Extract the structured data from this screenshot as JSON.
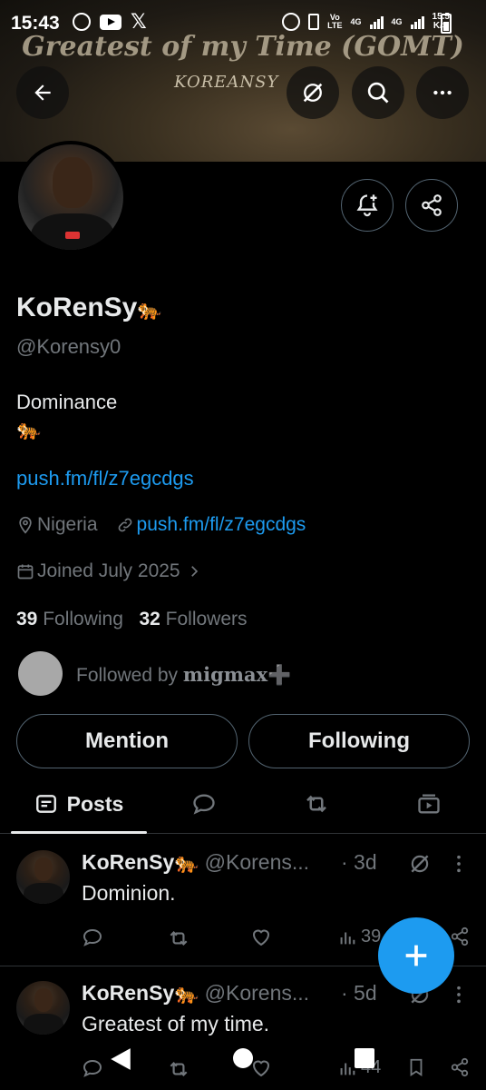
{
  "status_bar": {
    "time": "15:43",
    "net_left": "Vo",
    "net_left2": "LTE",
    "lte1": "4G",
    "lte2": "4G",
    "speed_top": "15.5",
    "speed_bottom": "K/S",
    "app_icons": [
      "whatsapp-icon",
      "youtube-icon",
      "x-icon"
    ]
  },
  "banner": {
    "title": "Greatest of my Time (GOMT)",
    "subtitle": "KOREANSY"
  },
  "profile": {
    "name": "KoRenSy",
    "name_emoji": "🐅",
    "handle": "@Korensy0",
    "bio_line1": "Dominance",
    "bio_line2": "🐅",
    "bio_link": "push.fm/fl/z7egcdgs",
    "location": "Nigeria",
    "website": "push.fm/fl/z7egcdgs",
    "joined": "Joined July 2025",
    "following_count": "39",
    "following_label": "Following",
    "followers_count": "32",
    "followers_label": "Followers",
    "followed_by_prefix": "Followed by",
    "followed_by_name": "migmax",
    "followed_by_suffix": "➕"
  },
  "buttons": {
    "mention": "Mention",
    "following": "Following"
  },
  "tabs": {
    "posts": "Posts"
  },
  "posts": [
    {
      "name": "KoRenSy",
      "name_emoji": "🐅",
      "handle": "@Korens...",
      "time": "· 3d",
      "text": "Dominion.",
      "views": "39"
    },
    {
      "name": "KoRenSy",
      "name_emoji": "🐅",
      "handle": "@Korens...",
      "time": "· 5d",
      "text": "Greatest of my time.",
      "views": "44"
    }
  ],
  "colors": {
    "accent": "#1d9bf0",
    "muted": "#71767b",
    "border": "#536471",
    "background": "#000000"
  }
}
